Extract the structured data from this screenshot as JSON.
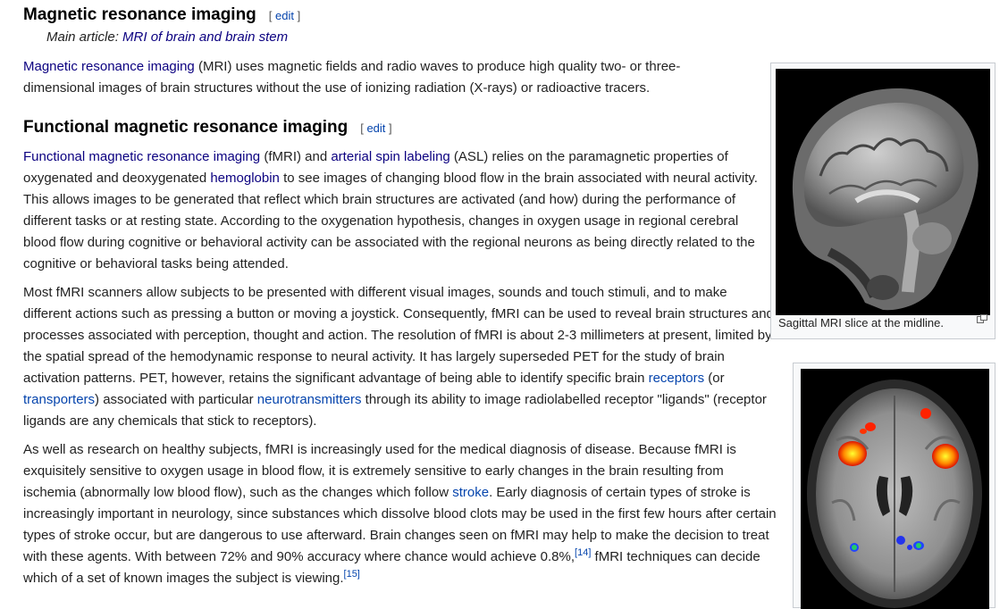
{
  "section_mri": {
    "heading": "Magnetic resonance imaging",
    "edit_open": "[",
    "edit_label": "edit",
    "edit_close": "]",
    "hatnote_prefix": "Main article: ",
    "hatnote_link": "MRI of brain and brain stem",
    "para": {
      "link": "Magnetic resonance imaging",
      "text": " (MRI) uses magnetic fields and radio waves to produce high quality two- or three-dimensional images of brain structures without the use of ionizing radiation (X-rays) or radioactive tracers."
    }
  },
  "section_fmri": {
    "heading": "Functional magnetic resonance imaging",
    "edit_open": "[",
    "edit_label": "edit",
    "edit_close": "]",
    "p1": {
      "link1": "Functional magnetic resonance imaging",
      "t1": " (fMRI) and ",
      "link2": "arterial spin labeling",
      "t2": " (ASL) relies on the paramagnetic properties of oxygenated and deoxygenated ",
      "link3": "hemoglobin",
      "t3": " to see images of changing blood flow in the brain associated with neural activity. This allows images to be generated that reflect which brain structures are activated (and how) during the performance of different tasks or at resting state. According to the oxygenation hypothesis, changes in oxygen usage in regional cerebral blood flow during cognitive or behavioral activity can be associated with the regional neurons as being directly related to the cognitive or behavioral tasks being attended."
    },
    "p2": {
      "t1": "Most fMRI scanners allow subjects to be presented with different visual images, sounds and touch stimuli, and to make different actions such as pressing a button or moving a joystick. Consequently, fMRI can be used to reveal brain structures and processes associated with perception, thought and action. The resolution of fMRI is about 2-3 millimeters at present, limited by the spatial spread of the hemodynamic response to neural activity. It has largely superseded PET for the study of brain activation patterns. PET, however, retains the significant advantage of being able to identify specific brain ",
      "link1": "receptors",
      "t2": " (or ",
      "link2": "transporters",
      "t3": ") associated with particular ",
      "link3": "neurotransmitters",
      "t4": " through its ability to image radiolabelled receptor \"ligands\" (receptor ligands are any chemicals that stick to receptors)."
    },
    "p3": {
      "t1": "As well as research on healthy subjects, fMRI is increasingly used for the medical diagnosis of disease. Because fMRI is exquisitely sensitive to oxygen usage in blood flow, it is extremely sensitive to early changes in the brain resulting from ischemia (abnormally low blood flow), such as the changes which follow ",
      "link1": "stroke",
      "t2": ". Early diagnosis of certain types of stroke is increasingly important in neurology, since substances which dissolve blood clots may be used in the first few hours after certain types of stroke occur, but are dangerous to use afterward. Brain changes seen on fMRI may help to make the decision to treat with these agents. With between 72% and 90% accuracy where chance would achieve 0.8%,",
      "ref1": "[14]",
      "t3": " fMRI techniques can decide which of a set of known images the subject is viewing.",
      "ref2": "[15]"
    }
  },
  "figure1": {
    "caption": "Sagittal MRI slice at the midline.",
    "icon": "enlarge-icon"
  },
  "figure2": {
    "icon": "none"
  }
}
